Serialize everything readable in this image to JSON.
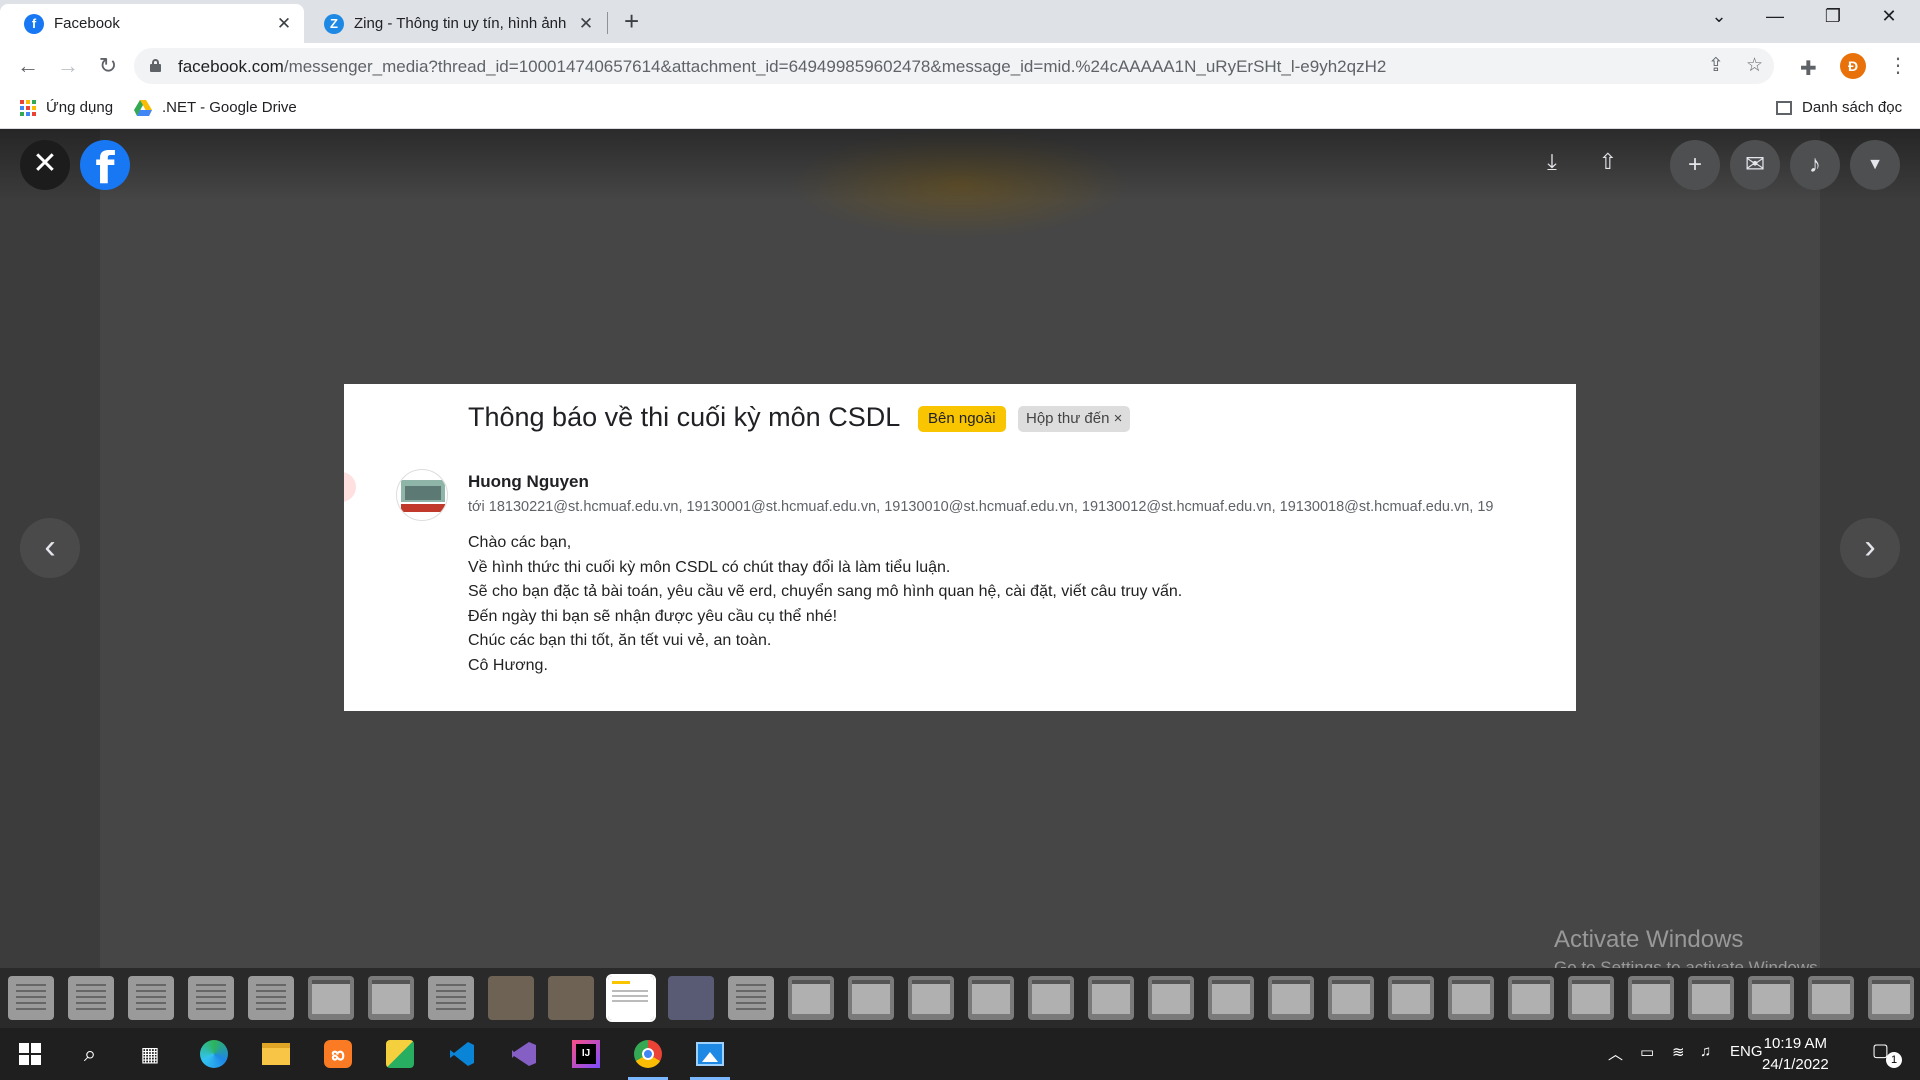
{
  "browser": {
    "tabs": [
      {
        "title": "Facebook",
        "favicon": "facebook-icon",
        "active": true
      },
      {
        "title": "Zing - Thông tin uy tín, hình ảnh",
        "favicon": "zing-icon",
        "active": false
      }
    ],
    "new_tab_symbol": "+",
    "url_host": "facebook.com",
    "url_path": "/messenger_media?thread_id=100014740657614&attachment_id=649499859602478&message_id=mid.%24cAAAAA1N_uRyErSHt_l-e9yh2qzH2",
    "profile_initial": "Đ",
    "bookmarks": [
      {
        "label": "Ứng dụng",
        "icon": "apps-grid-icon"
      },
      {
        "label": ".NET - Google Drive",
        "icon": "google-drive-icon"
      }
    ],
    "reading_list_label": "Danh sách đọc"
  },
  "viewer": {
    "brand_letter": "f",
    "email": {
      "subject": "Thông báo về thi cuối kỳ môn CSDL",
      "chip_external": "Bên ngoài",
      "chip_inbox": "Hộp thư đến",
      "chip_inbox_close": "×",
      "sender": "Huong Nguyen",
      "recipients": "tới 18130221@st.hcmuaf.edu.vn, 19130001@st.hcmuaf.edu.vn, 19130010@st.hcmuaf.edu.vn, 19130012@st.hcmuaf.edu.vn, 19130018@st.hcmuaf.edu.vn, 19",
      "body": [
        "Chào các bạn,",
        "Về hình thức thi cuối kỳ môn CSDL có chút thay đổi là làm tiểu luận.",
        "Sẽ cho bạn đặc tả bài toán, yêu cầu vẽ erd, chuyển sang mô hình quan hệ, cài đặt, viết câu truy vấn.",
        "Đến ngày thi bạn sẽ nhận được yêu cầu cụ thể nhé!",
        "Chúc các bạn thi tốt, ăn tết vui vẻ, an toàn.",
        "Cô Hương."
      ]
    },
    "watermark": {
      "line1": "Activate Windows",
      "line2": "Go to Settings to activate Windows."
    },
    "thumbnails": [
      "doc",
      "doc",
      "doc",
      "doc",
      "doc",
      "screen",
      "screen",
      "doc",
      "photo",
      "photo",
      "current",
      "dark",
      "doc",
      "screen",
      "screen",
      "screen",
      "screen",
      "screen",
      "screen",
      "screen",
      "screen",
      "screen",
      "screen",
      "screen",
      "screen",
      "screen",
      "screen",
      "screen",
      "screen",
      "screen",
      "screen",
      "screen"
    ]
  },
  "taskbar": {
    "language": "ENG",
    "time": "10:19 AM",
    "date": "24/1/2022",
    "notification_count": "1"
  },
  "colors": {
    "facebook_blue": "#1877f2",
    "chip_yellow": "#f9c400",
    "profile_orange": "#e8710a",
    "taskbar": "#1f1f1f"
  }
}
